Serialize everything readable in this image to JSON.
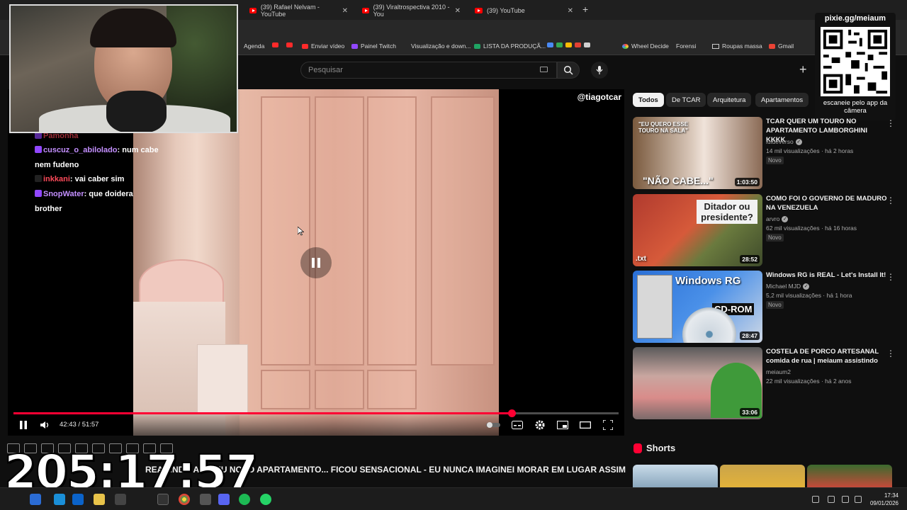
{
  "browser": {
    "tabs": [
      {
        "label": "(39) Rafael Nelvam - YouTube"
      },
      {
        "label": "(39) Viraltrospectiva 2010 - You"
      },
      {
        "label": "(39) YouTube"
      }
    ],
    "bookmarks": [
      {
        "label": "Agenda"
      },
      {
        "label": "Enviar vídeo"
      },
      {
        "label": "Painel Twitch"
      },
      {
        "label": "Visualização e down..."
      },
      {
        "label": "LISTA DA PRODUÇÃ..."
      },
      {
        "label": "Wheel Decide"
      },
      {
        "label": "Forensi"
      },
      {
        "label": "Roupas massa"
      },
      {
        "label": "Gmail"
      }
    ]
  },
  "youtube": {
    "search_placeholder": "Pesquisar",
    "chips": [
      "Todos",
      "De TCAR",
      "Arquitetura",
      "Apartamentos"
    ],
    "player": {
      "watermark": "@tiagotcar",
      "time": "42:43 / 51:57",
      "progress": 0.823
    },
    "video_title": "REAGINDO AO MEU NOVO APARTAMENTO... FICOU SENSACIONAL - EU NUNCA IMAGINEI MORAR EM LUGAR ASSIM",
    "recommendations": [
      {
        "title": "TCAR QUER UM TOURO NO APARTAMENTO LAMBORGHINI KKKK",
        "channel": "luideverso",
        "meta": "14 mil visualizações · há 2 horas",
        "badge": "Novo",
        "duration": "1:03:50",
        "thumb_text": "\"NÃO CABE...\"",
        "thumb_text2": "\"EU QUERO ESSE TOURO NA SALA\""
      },
      {
        "title": "COMO FOI O GOVERNO DE MADURO NA VENEZUELA",
        "channel": "arvro",
        "meta": "62 mil visualizações · há 16 horas",
        "badge": "Novo",
        "duration": "28:52",
        "thumb_text": "Ditador ou presidente?",
        "thumb_text2": ".txt"
      },
      {
        "title": "Windows RG is REAL - Let's Install It!",
        "channel": "Michael MJD",
        "meta": "5,2 mil visualizações · há 1 hora",
        "badge": "Novo",
        "duration": "28:47",
        "thumb_text": "Windows RG",
        "thumb_text2": "CD-ROM"
      },
      {
        "title": "COSTELA DE PORCO ARTESANAL comida de rua | meiaum assistindo",
        "channel": "meiaum2",
        "meta": "22 mil visualizações · há 2 anos",
        "badge": "",
        "duration": "33:06",
        "thumb_text": "",
        "thumb_text2": ""
      }
    ],
    "shorts_label": "Shorts"
  },
  "chat": [
    {
      "user": "Pamonha",
      "text": ""
    },
    {
      "user": "cuscuz_o_abilolado",
      "text": "num cabe"
    },
    {
      "user": "",
      "text": "nem fudeno"
    },
    {
      "user": "inkkani",
      "text": "vai caber sim"
    },
    {
      "user": "SnopWater",
      "text": "que doidera"
    },
    {
      "user": "",
      "text": "brother"
    }
  ],
  "overlay": {
    "qr_url": "pixie.gg/meiaum",
    "qr_caption": "escaneie pelo app da câmera",
    "stream_timer": "205:17:57"
  },
  "taskbar": {
    "time": "17:34",
    "date": "09/01/2026"
  },
  "colors": {
    "youtube_red": "#ff0033",
    "chat_user_purple": "#c38fff",
    "chat_user_red": "#ff4a5a",
    "background": "#0f0f0f"
  }
}
